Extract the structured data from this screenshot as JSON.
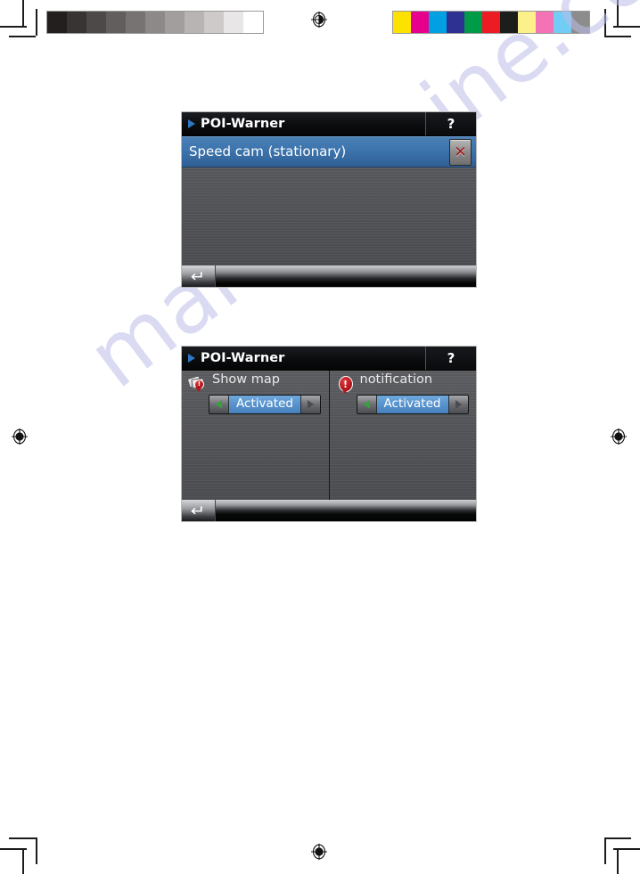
{
  "page": {
    "watermark_text": "manualshine.com"
  },
  "calibration": {
    "gray_ramp_label": "grayscale-step-wedge",
    "gray_steps": [
      "#231f1f",
      "#383434",
      "#4d4949",
      "#625e5e",
      "#777373",
      "#8d8989",
      "#a29e9e",
      "#b8b4b4",
      "#cecaca",
      "#e8e6e6",
      "#ffffff"
    ],
    "color_label": "process-color-control-bar",
    "color_steps": [
      "#fde100",
      "#e6008b",
      "#00a0e3",
      "#2e3192",
      "#009b48",
      "#ed1c24",
      "#1d1d1b",
      "#fbf08a",
      "#f472b6",
      "#72cdf4",
      "#8c8c8c"
    ],
    "registration_mark": "registration-target"
  },
  "screens": [
    {
      "id": "poi-warner-list",
      "titlebar": {
        "title": "POI-Warner",
        "help_label": "?",
        "arrow_icon": "play-triangle-icon"
      },
      "rows": [
        {
          "label": "Speed cam (stationary)",
          "selected": true,
          "close_label": "✕"
        }
      ],
      "bottombar": {
        "back_label": "↵"
      }
    },
    {
      "id": "poi-warner-settings",
      "titlebar": {
        "title": "POI-Warner",
        "help_label": "?",
        "arrow_icon": "play-triangle-icon"
      },
      "panes": [
        {
          "icon": "map-cards-warning-icon",
          "title": "Show map",
          "spinner": {
            "value": "Activated",
            "prev_label": "◀",
            "next_label": "▶"
          }
        },
        {
          "icon": "exclamation-badge-icon",
          "title": "notification",
          "spinner": {
            "value": "Activated",
            "prev_label": "◀",
            "next_label": "▶"
          }
        }
      ],
      "bottombar": {
        "back_label": "↵"
      }
    }
  ],
  "colors": {
    "accent_blue": "#4781bd",
    "title_arrow_blue": "#2e77c4",
    "spinner_green": "#36a03a",
    "close_x_red": "#a01c22",
    "screen_gray": "#55565a"
  }
}
